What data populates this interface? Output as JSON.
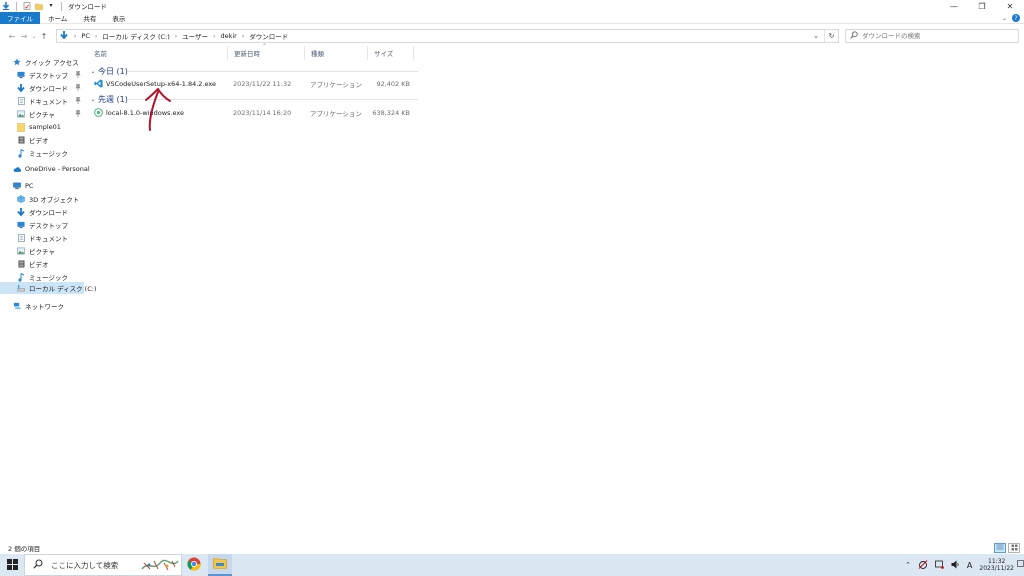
{
  "window": {
    "title": "ダウンロード",
    "controls": {
      "minimize": "—",
      "maximize": "❐",
      "close": "✕"
    }
  },
  "ribbon": {
    "tabs": [
      "ファイル",
      "ホーム",
      "共有",
      "表示"
    ]
  },
  "address": {
    "crumbs": [
      "PC",
      "ローカル ディスク (C:)",
      "ユーザー",
      "dekir",
      "ダウンロード"
    ],
    "separator": "›"
  },
  "search": {
    "placeholder": "ダウンロードの検索"
  },
  "nav": {
    "quick_access": "クイック アクセス",
    "quick_items": [
      {
        "label": "デスクトップ",
        "icon": "desktop-icon",
        "pinned": true
      },
      {
        "label": "ダウンロード",
        "icon": "download-icon",
        "pinned": true
      },
      {
        "label": "ドキュメント",
        "icon": "documents-icon",
        "pinned": true
      },
      {
        "label": "ピクチャ",
        "icon": "pictures-icon",
        "pinned": true
      },
      {
        "label": "sample01",
        "icon": "folder-icon",
        "pinned": false
      },
      {
        "label": "ビデオ",
        "icon": "videos-icon",
        "pinned": false
      },
      {
        "label": "ミュージック",
        "icon": "music-icon",
        "pinned": false
      }
    ],
    "onedrive": "OneDrive - Personal",
    "pc": "PC",
    "pc_items": [
      {
        "label": "3D オブジェクト",
        "icon": "3d-objects-icon"
      },
      {
        "label": "ダウンロード",
        "icon": "download-icon"
      },
      {
        "label": "デスクトップ",
        "icon": "desktop-icon"
      },
      {
        "label": "ドキュメント",
        "icon": "documents-icon"
      },
      {
        "label": "ピクチャ",
        "icon": "pictures-icon"
      },
      {
        "label": "ビデオ",
        "icon": "videos-icon"
      },
      {
        "label": "ミュージック",
        "icon": "music-icon"
      },
      {
        "label": "ローカル ディスク (C:)",
        "icon": "local-disk-icon",
        "selected": true
      }
    ],
    "network": "ネットワーク"
  },
  "columns": {
    "name": "名前",
    "date": "更新日時",
    "type": "種類",
    "size": "サイズ"
  },
  "groups": [
    {
      "label": "今日 (1)",
      "files": [
        {
          "name": "VSCodeUserSetup-x64-1.84.2.exe",
          "date": "2023/11/22 11:32",
          "type": "アプリケーション",
          "size": "92,402 KB",
          "icon": "vscode-icon"
        }
      ]
    },
    {
      "label": "先週 (1)",
      "files": [
        {
          "name": "local-8.1.0-windows.exe",
          "date": "2023/11/14 16:20",
          "type": "アプリケーション",
          "size": "638,324 KB",
          "icon": "local-app-icon"
        }
      ]
    }
  ],
  "status": {
    "item_count": "2 個の項目"
  },
  "taskbar": {
    "search_placeholder": "ここに入力して検索",
    "ime": "A",
    "time": "11:32",
    "date": "2023/11/22"
  },
  "colors": {
    "accent": "#1979ca",
    "selection": "#cce4f7",
    "group_text": "#1e3f8a",
    "taskbar": "#dbe7f3",
    "annotation": "#b3122a"
  }
}
